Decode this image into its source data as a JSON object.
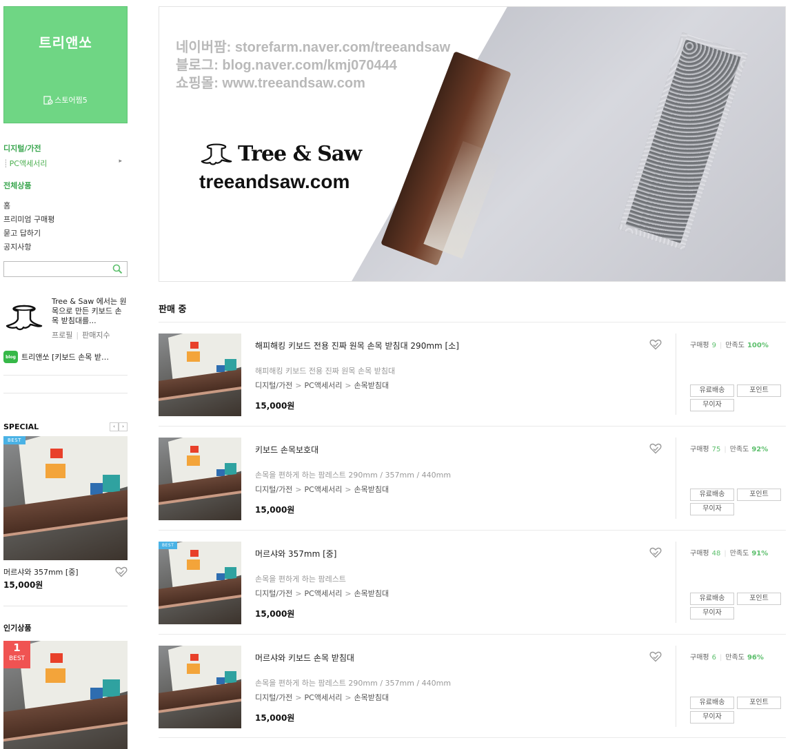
{
  "store": {
    "name": "트리앤쏘",
    "grade": "스토어찜5"
  },
  "sidebar": {
    "category_title": "디지털/가전",
    "category_sub": "PC액세서리",
    "all_title": "전체상품",
    "menu": [
      "홈",
      "프리미엄 구매평",
      "묻고 답하기",
      "공지사항"
    ],
    "search_placeholder": ""
  },
  "profile": {
    "description": "Tree & Saw 에서는 원목으로 만든 키보드 손목 받침대를...",
    "link_profile": "프로필",
    "link_index": "판매지수",
    "blog_badge": "blog",
    "blog_text": "트리앤쏘 [키보드 손목 받…"
  },
  "special": {
    "title": "SPECIAL",
    "prev": "‹",
    "next": "›",
    "badge": "BEST",
    "name": "머르샤와 357mm [중]",
    "price": "15,000원"
  },
  "popular": {
    "title": "인기상품",
    "rank": "1",
    "rank_label": "BEST"
  },
  "banner": {
    "url_lines": [
      "네이버팜: storefarm.naver.com/treeandsaw",
      "블로그: blog.naver.com/kmj070444",
      "쇼핑몰: www.treeandsaw.com"
    ],
    "brand_name": "Tree & Saw",
    "brand_url": "treeandsaw.com"
  },
  "main": {
    "section_title": "판매 중",
    "review_label": "구매평",
    "satisfaction_label": "만족도",
    "tags": [
      "유료배송",
      "포인트",
      "무이자"
    ],
    "products": [
      {
        "title": "해피해킹 키보드 전용 진짜 원목 손목 받침대 290mm [소]",
        "desc": "해피해킹 키보드 전용 진짜 원목 손목 받침대",
        "cat1": "디지털/가전",
        "cat2": "PC액세서리",
        "cat3": "손목받침대",
        "price": "15,000원",
        "reviews": "9",
        "satisfaction": "100%",
        "badge": ""
      },
      {
        "title": "키보드 손목보호대",
        "desc": "손목을 편하게 하는 팜레스트 290mm / 357mm / 440mm",
        "cat1": "디지털/가전",
        "cat2": "PC액세서리",
        "cat3": "손목받침대",
        "price": "15,000원",
        "reviews": "75",
        "satisfaction": "92%",
        "badge": ""
      },
      {
        "title": "머르샤와 357mm [중]",
        "desc": "손목을 편하게 하는 팜레스트",
        "cat1": "디지털/가전",
        "cat2": "PC액세서리",
        "cat3": "손목받침대",
        "price": "15,000원",
        "reviews": "48",
        "satisfaction": "91%",
        "badge": "BEST"
      },
      {
        "title": "머르샤와 키보드 손목 받침대",
        "desc": "손목을 편하게 하는 팜레스트 290mm / 357mm / 440mm",
        "cat1": "디지털/가전",
        "cat2": "PC액세서리",
        "cat3": "손목받침대",
        "price": "15,000원",
        "reviews": "6",
        "satisfaction": "96%",
        "badge": ""
      }
    ]
  }
}
